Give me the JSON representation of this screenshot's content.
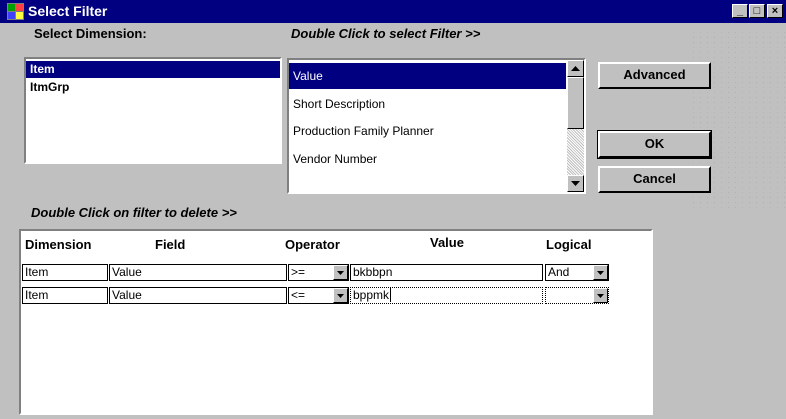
{
  "window": {
    "title": "Select Filter",
    "controls": {
      "minimize": "_",
      "maximize": "□",
      "close": "×"
    }
  },
  "dimension_panel": {
    "label": "Select Dimension:",
    "items": [
      {
        "label": "Item",
        "selected": true
      },
      {
        "label": "ItmGrp",
        "selected": false
      }
    ]
  },
  "filter_panel": {
    "label": "Double Click to select Filter >>",
    "items": [
      {
        "label": "Value",
        "selected": true
      },
      {
        "label": "Short Description",
        "selected": false
      },
      {
        "label": "Production Family Planner",
        "selected": false
      },
      {
        "label": "Vendor Number",
        "selected": false
      }
    ]
  },
  "buttons": {
    "advanced": "Advanced",
    "ok": "OK",
    "cancel": "Cancel"
  },
  "grid_section": {
    "label": "Double Click on filter to delete  >>",
    "headers": {
      "dimension": "Dimension",
      "field": "Field",
      "operator": "Operator",
      "value": "Value",
      "logical": "Logical"
    },
    "rows": [
      {
        "dimension": "Item",
        "field": "Value",
        "operator": ">=",
        "value": "bkbbpn",
        "logical": "And"
      },
      {
        "dimension": "Item",
        "field": "Value",
        "operator": "<=",
        "value": "bppmk",
        "logical": ""
      }
    ]
  },
  "colors": {
    "titlebar": "#000080",
    "selection": "#000080",
    "face": "#c0c0c0"
  }
}
